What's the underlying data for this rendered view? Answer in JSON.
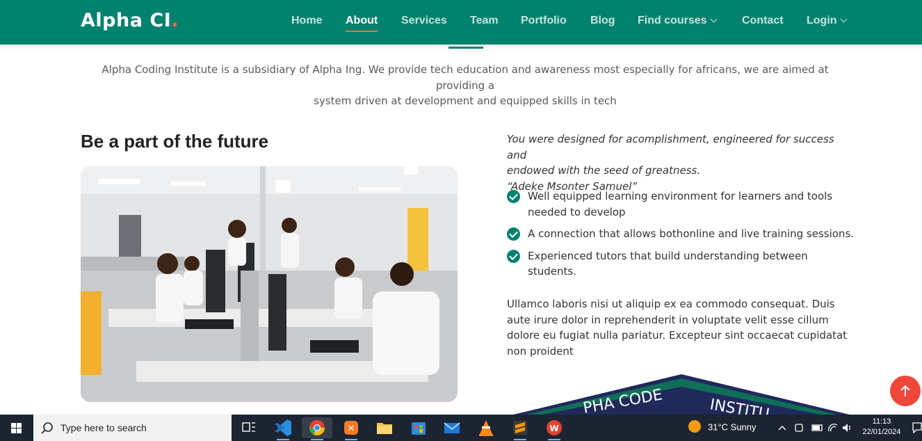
{
  "brand": {
    "name": "Alpha CI",
    "dot": ".",
    "dot_color": "#ff6a3d"
  },
  "colors": {
    "primary": "#00826f",
    "accent": "#ff6a3d",
    "scroll_button": "#f0473a",
    "taskbar": "#1b2430"
  },
  "nav": {
    "items": [
      {
        "label": "Home"
      },
      {
        "label": "About",
        "active": true
      },
      {
        "label": "Services"
      },
      {
        "label": "Team"
      },
      {
        "label": "Portfolio"
      },
      {
        "label": "Blog"
      },
      {
        "label": "Find courses",
        "dropdown": true
      },
      {
        "label": "Contact"
      },
      {
        "label": "Login",
        "dropdown": true
      }
    ]
  },
  "about": {
    "intro_line1": "Alpha Coding Institute is a subsidiary of Alpha Ing. We provide tech education and awareness most especially for africans, we are aimed at providing a",
    "intro_line2": "system driven at development and equipped skills in tech",
    "heading": "Be a part of the future",
    "image_alt": "Students in a computer lab",
    "quote_line1": "You were designed for acomplishment, engineered for success and",
    "quote_line2": "endowed with the seed of greatness.",
    "quote_author": "“Adeke Msonter Samuel”",
    "features": [
      "Well equipped learning environment for learners and tools needed to develop",
      "A connection that allows bothonline and live training sessions.",
      "Experienced tutors that build understanding between students."
    ],
    "paragraph": "Ullamco laboris nisi ut aliquip ex ea commodo consequat. Duis aute irure dolor in reprehenderit in voluptate velit esse cillum dolore eu fugiat nulla pariatur. Excepteur sint occaecat cupidatat non proident",
    "badge_text_1": "PHA CODE",
    "badge_text_2": "INSTITU"
  },
  "taskbar": {
    "search_placeholder": "Type here to search",
    "weather": "31°C  Sunny",
    "time": "11:13",
    "date": "22/01/2024",
    "icons": [
      "task-view",
      "vscode",
      "chrome",
      "xampp",
      "file-explorer",
      "microsoft-store",
      "mail",
      "vlc",
      "sublime-text",
      "wps-office"
    ]
  }
}
